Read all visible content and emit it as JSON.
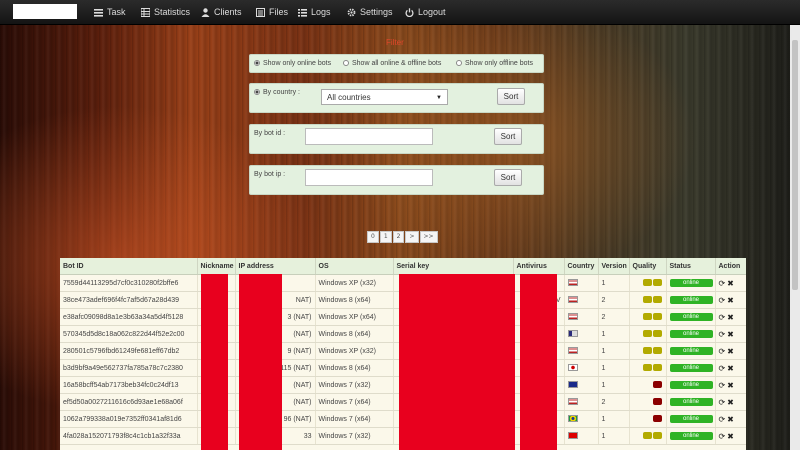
{
  "navbar": {
    "brand": "",
    "items": [
      {
        "label": "Task",
        "icon": "tasks-icon"
      },
      {
        "label": "Statistics",
        "icon": "statistics-icon"
      },
      {
        "label": "Clients",
        "icon": "user-icon"
      },
      {
        "label": "Files",
        "icon": "files-icon"
      },
      {
        "label": "Logs",
        "icon": "logs-icon"
      },
      {
        "label": "Settings",
        "icon": "gear-icon"
      },
      {
        "label": "Logout",
        "icon": "power-icon"
      }
    ]
  },
  "filter": {
    "title": "Filter",
    "status_options": [
      "Show only online bots",
      "Show all online & offline bots",
      "Show only offline bots"
    ],
    "selected_status": "Show only online bots",
    "country_label": "By country :",
    "country_value": "All countries",
    "botid_label": "By bot id :",
    "botid_value": "",
    "botip_label": "By bot ip :",
    "botip_value": "",
    "sort_label": "Sort"
  },
  "pagination": [
    "0",
    "1",
    "2",
    ">",
    ">>"
  ],
  "table": {
    "headers": [
      "Bot ID",
      "Nickname",
      "IP address",
      "OS",
      "Serial key",
      "Antivirus",
      "Country",
      "Version",
      "Quality",
      "Status",
      "Action"
    ],
    "rows": [
      {
        "bot_id": "7559d44113295d7cf0c310280f2bffe6",
        "ip": "",
        "os": "Windows XP (x32)",
        "av": "",
        "flag": "us",
        "version": "1",
        "quality": "mid",
        "status": "online"
      },
      {
        "bot_id": "38ce473adef696f4fc7af5d67a28d439",
        "ip": "NAT)",
        "os": "Windows 8 (x64)",
        "av": "AV",
        "flag": "us",
        "version": "2",
        "quality": "mid",
        "status": "online"
      },
      {
        "bot_id": "e38afc09098d8a1e3b63a34a5d4f5128",
        "ip": "3 (NAT)",
        "os": "Windows XP (x64)",
        "av": "",
        "flag": "us",
        "version": "2",
        "quality": "mid",
        "status": "online"
      },
      {
        "bot_id": "570345d5d8c18a062c822d44f52e2c00",
        "ip": "(NAT)",
        "os": "Windows 8 (x64)",
        "av": "",
        "flag": "other",
        "version": "1",
        "quality": "mid",
        "status": "online"
      },
      {
        "bot_id": "280501c5796fbd61249fe681eff67db2",
        "ip": "9 (NAT)",
        "os": "Windows XP (x32)",
        "av": "",
        "flag": "us",
        "version": "1",
        "quality": "mid",
        "status": "online"
      },
      {
        "bot_id": "b3d9bf9a49e562737fa785a78c7c2380",
        "ip": "115 (NAT)",
        "os": "Windows 8 (x64)",
        "av": "",
        "flag": "jp",
        "version": "1",
        "quality": "mid",
        "status": "online"
      },
      {
        "bot_id": "16a58bcff54ab7173beb34fc0c24df13",
        "ip": "(NAT)",
        "os": "Windows 7 (x32)",
        "av": "",
        "flag": "au",
        "version": "1",
        "quality": "low",
        "status": "online"
      },
      {
        "bot_id": "ef5d50a0027211616c6d93ae1e68a06f",
        "ip": "(NAT)",
        "os": "Windows 7 (x64)",
        "av": "",
        "flag": "us",
        "version": "2",
        "quality": "low",
        "status": "online"
      },
      {
        "bot_id": "1062a799338a019e7352ff0341af81d6",
        "ip": "96 (NAT)",
        "os": "Windows 7 (x64)",
        "av": "",
        "flag": "br",
        "version": "1",
        "quality": "low",
        "status": "online"
      },
      {
        "bot_id": "4fa028a152071793f8c4c1cb1a32f33a",
        "ip": "33",
        "os": "Windows 7 (x32)",
        "av": "",
        "flag": "cn",
        "version": "1",
        "quality": "mid",
        "status": "online"
      }
    ]
  }
}
